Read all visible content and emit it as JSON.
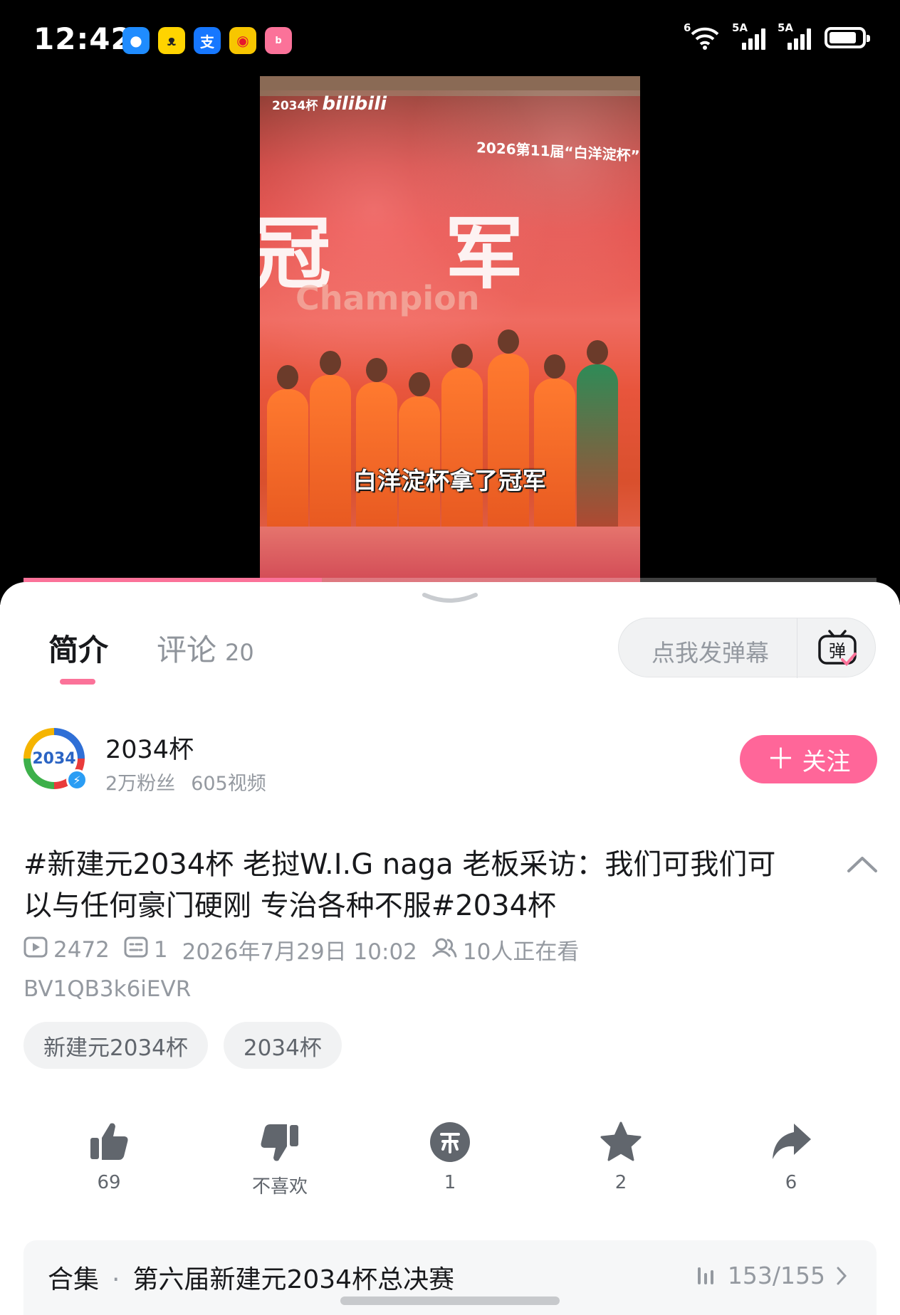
{
  "status_bar": {
    "time": "12:42",
    "app_icons": [
      "message-icon",
      "rabbit-app-icon",
      "alipay-icon",
      "weibo-icon",
      "bilibili-icon"
    ],
    "alipay_glyph": "支",
    "wifi_tag": "6",
    "signal_1_tag": "5A",
    "signal_2_tag": "5A",
    "battery_level": 0.85
  },
  "video": {
    "corner_tag": "2034杯",
    "corner_brand": "bilibili",
    "event_line": "2026第11届“白洋淀杯”",
    "champion_text": "冠军",
    "champion_en": "Champion",
    "caption": "白洋淀杯拿了冠军",
    "progress": 0.35,
    "accent_color": "#fb7299"
  },
  "tabs": {
    "intro": "简介",
    "comments": "评论",
    "comments_count": "20"
  },
  "danmaku": {
    "placeholder": "点我发弹幕",
    "button_glyph": "弹"
  },
  "author": {
    "name": "2034杯",
    "followers": "2万粉丝",
    "videos": "605视频",
    "follow_label": "关注",
    "avatar_text": "2034"
  },
  "video_info": {
    "title": "#新建元2034杯 老挝W.I.G naga 老板采访：我们可我们可以与任何豪门硬刚 专治各种不服#2034杯",
    "plays": "2472",
    "danmaku_count": "1",
    "date": "2026年7月29日 10:02",
    "watching": "10人正在看",
    "bvid": "BV1QB3k6iEVR"
  },
  "tags": [
    "新建元2034杯",
    "2034杯"
  ],
  "actions": {
    "like": "69",
    "dislike": "不喜欢",
    "coin": "1",
    "favorite": "2",
    "share": "6"
  },
  "series": {
    "label": "合集",
    "separator": "·",
    "name": "第六届新建元2034杯总决赛",
    "progress_text": "153/155"
  }
}
